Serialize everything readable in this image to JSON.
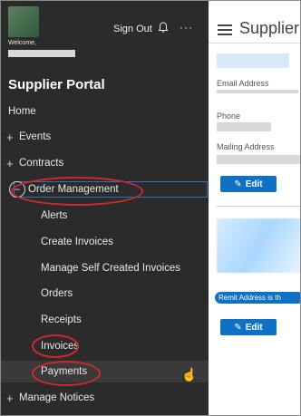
{
  "sidebar": {
    "welcome": "Welcome,",
    "sign_out": "Sign Out",
    "title": "Supplier Portal",
    "items": [
      {
        "label": "Home"
      },
      {
        "label": "Events"
      },
      {
        "label": "Contracts"
      },
      {
        "label": "Order Management"
      },
      {
        "label": "Alerts"
      },
      {
        "label": "Create Invoices"
      },
      {
        "label": "Manage Self Created Invoices"
      },
      {
        "label": "Orders"
      },
      {
        "label": "Receipts"
      },
      {
        "label": "Invoices"
      },
      {
        "label": "Payments"
      },
      {
        "label": "Manage Notices"
      }
    ]
  },
  "main": {
    "title": "Supplier -",
    "email_label": "Email Address",
    "phone_label": "Phone",
    "mailing_label": "Mailing Address",
    "edit_label": "Edit",
    "edit_label_2": "Edit",
    "remit_text": "Remit Address is th"
  },
  "colors": {
    "sidebar_bg": "#2b2b2b",
    "accent": "#0e71c6",
    "annotation": "#d0282d"
  }
}
